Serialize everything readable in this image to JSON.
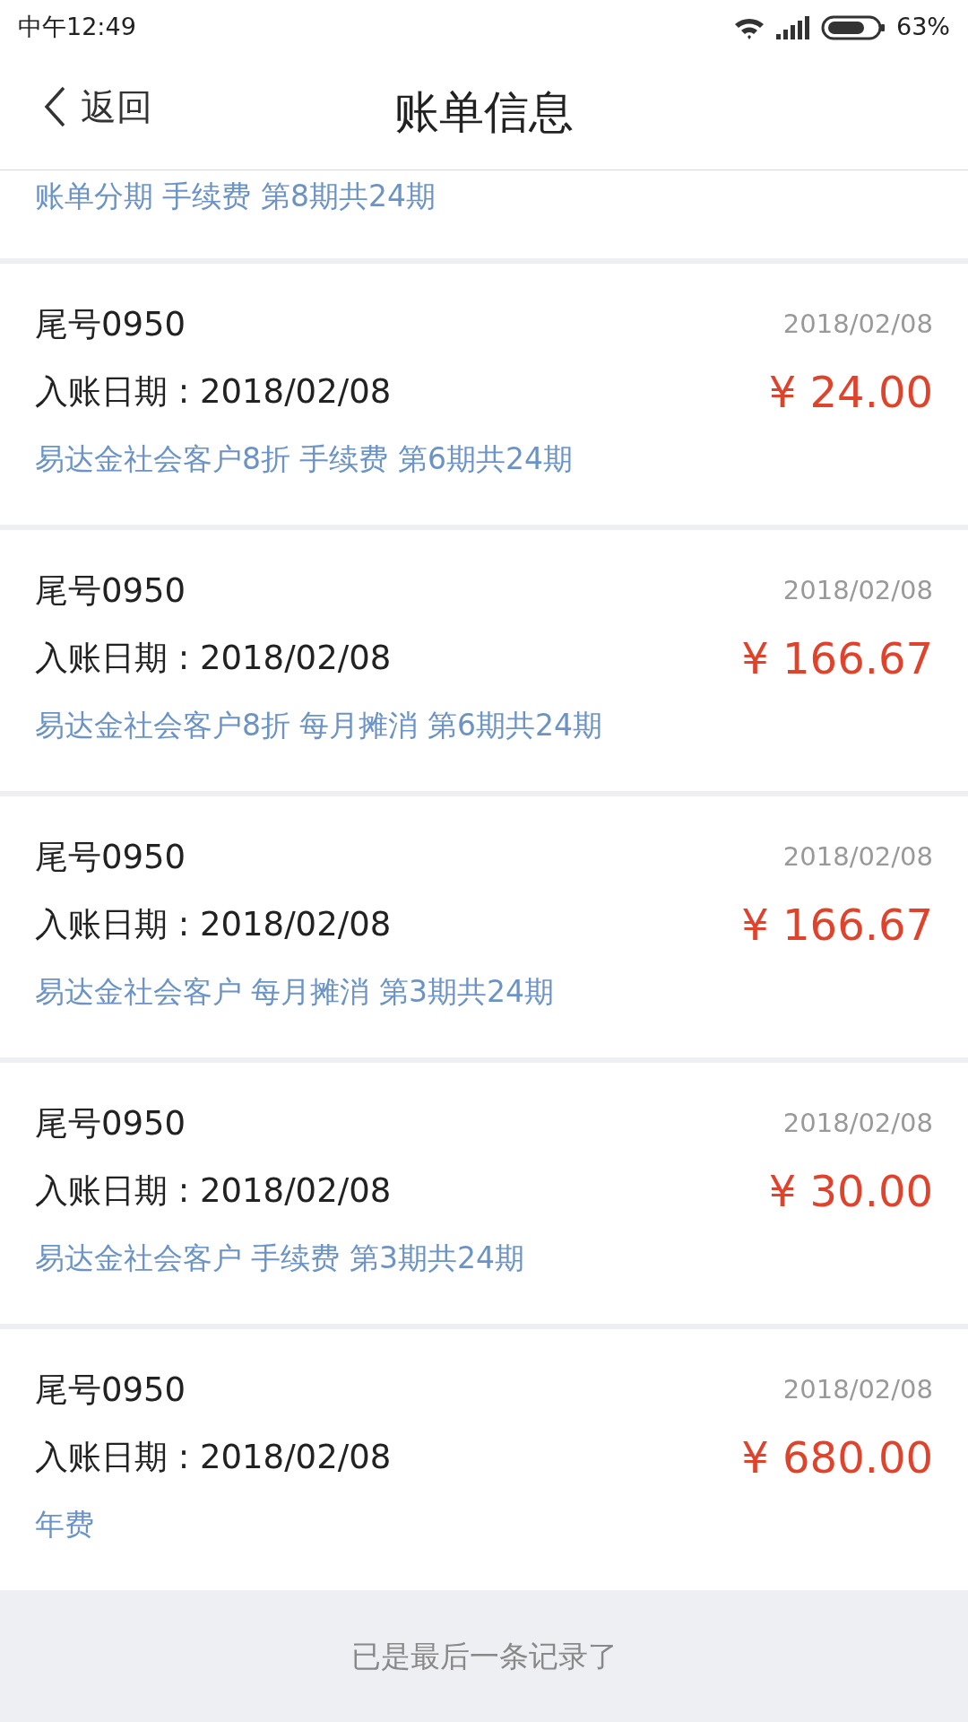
{
  "status_bar": {
    "time": "中午12:49",
    "battery": "63%"
  },
  "header": {
    "back": "返回",
    "title": "账单信息"
  },
  "partial_record": {
    "description": "账单分期 手续费 第8期共24期"
  },
  "records": [
    {
      "card": "尾号0950",
      "date": "2018/02/08",
      "posted": "入账日期 : 2018/02/08",
      "amount": "¥ 24.00",
      "description": "易达金社会客户8折 手续费 第6期共24期"
    },
    {
      "card": "尾号0950",
      "date": "2018/02/08",
      "posted": "入账日期 : 2018/02/08",
      "amount": "¥ 166.67",
      "description": "易达金社会客户8折 每月摊消 第6期共24期"
    },
    {
      "card": "尾号0950",
      "date": "2018/02/08",
      "posted": "入账日期 : 2018/02/08",
      "amount": "¥ 166.67",
      "description": "易达金社会客户 每月摊消 第3期共24期"
    },
    {
      "card": "尾号0950",
      "date": "2018/02/08",
      "posted": "入账日期 : 2018/02/08",
      "amount": "¥ 30.00",
      "description": "易达金社会客户 手续费 第3期共24期"
    },
    {
      "card": "尾号0950",
      "date": "2018/02/08",
      "posted": "入账日期 : 2018/02/08",
      "amount": "¥ 680.00",
      "description": "年费"
    }
  ],
  "footer_note": "已是最后一条记录了"
}
